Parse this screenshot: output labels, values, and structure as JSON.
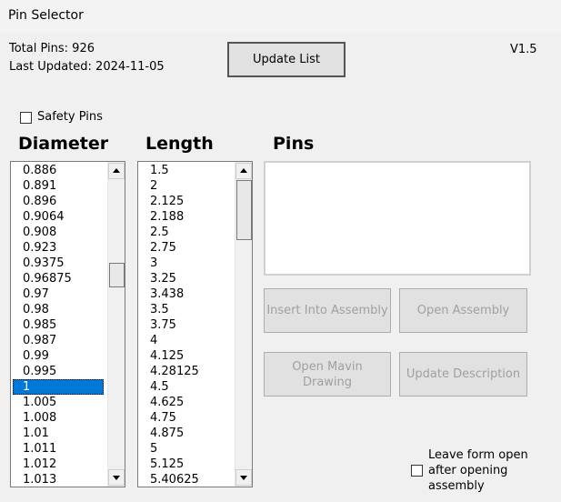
{
  "window": {
    "title": "Pin Selector"
  },
  "info": {
    "total_pins": "Total Pins: 926",
    "last_updated": "Last Updated: 2024-11-05",
    "version": "V1.5"
  },
  "buttons": {
    "update_list": "Update List",
    "insert_into_assembly": "Insert Into Assembly",
    "open_assembly": "Open Assembly",
    "open_mavin_drawing": "Open Mavin\nDrawing",
    "update_description": "Update Description"
  },
  "safety_pins": {
    "label": "Safety Pins",
    "checked": false
  },
  "headers": {
    "diameter": "Diameter",
    "length": "Length",
    "pins": "Pins"
  },
  "diameter_list": {
    "items": [
      "0.886",
      "0.891",
      "0.896",
      "0.9064",
      "0.908",
      "0.923",
      "0.9375",
      "0.96875",
      "0.97",
      "0.98",
      "0.985",
      "0.987",
      "0.99",
      "0.995",
      "1",
      "1.005",
      "1.008",
      "1.01",
      "1.011",
      "1.012",
      "1.013"
    ],
    "selected": "1"
  },
  "length_list": {
    "items": [
      "1.5",
      "2",
      "2.125",
      "2.188",
      "2.5",
      "2.75",
      "3",
      "3.25",
      "3.438",
      "3.5",
      "3.75",
      "4",
      "4.125",
      "4.28125",
      "4.5",
      "4.625",
      "4.75",
      "4.875",
      "5",
      "5.125",
      "5.40625"
    ]
  },
  "pins_list": {
    "items": []
  },
  "leave_form_open": {
    "label": "Leave form open\nafter opening\nassembly",
    "checked": false
  },
  "colors": {
    "selection": "#0078d7",
    "background": "#f0f0f0"
  }
}
